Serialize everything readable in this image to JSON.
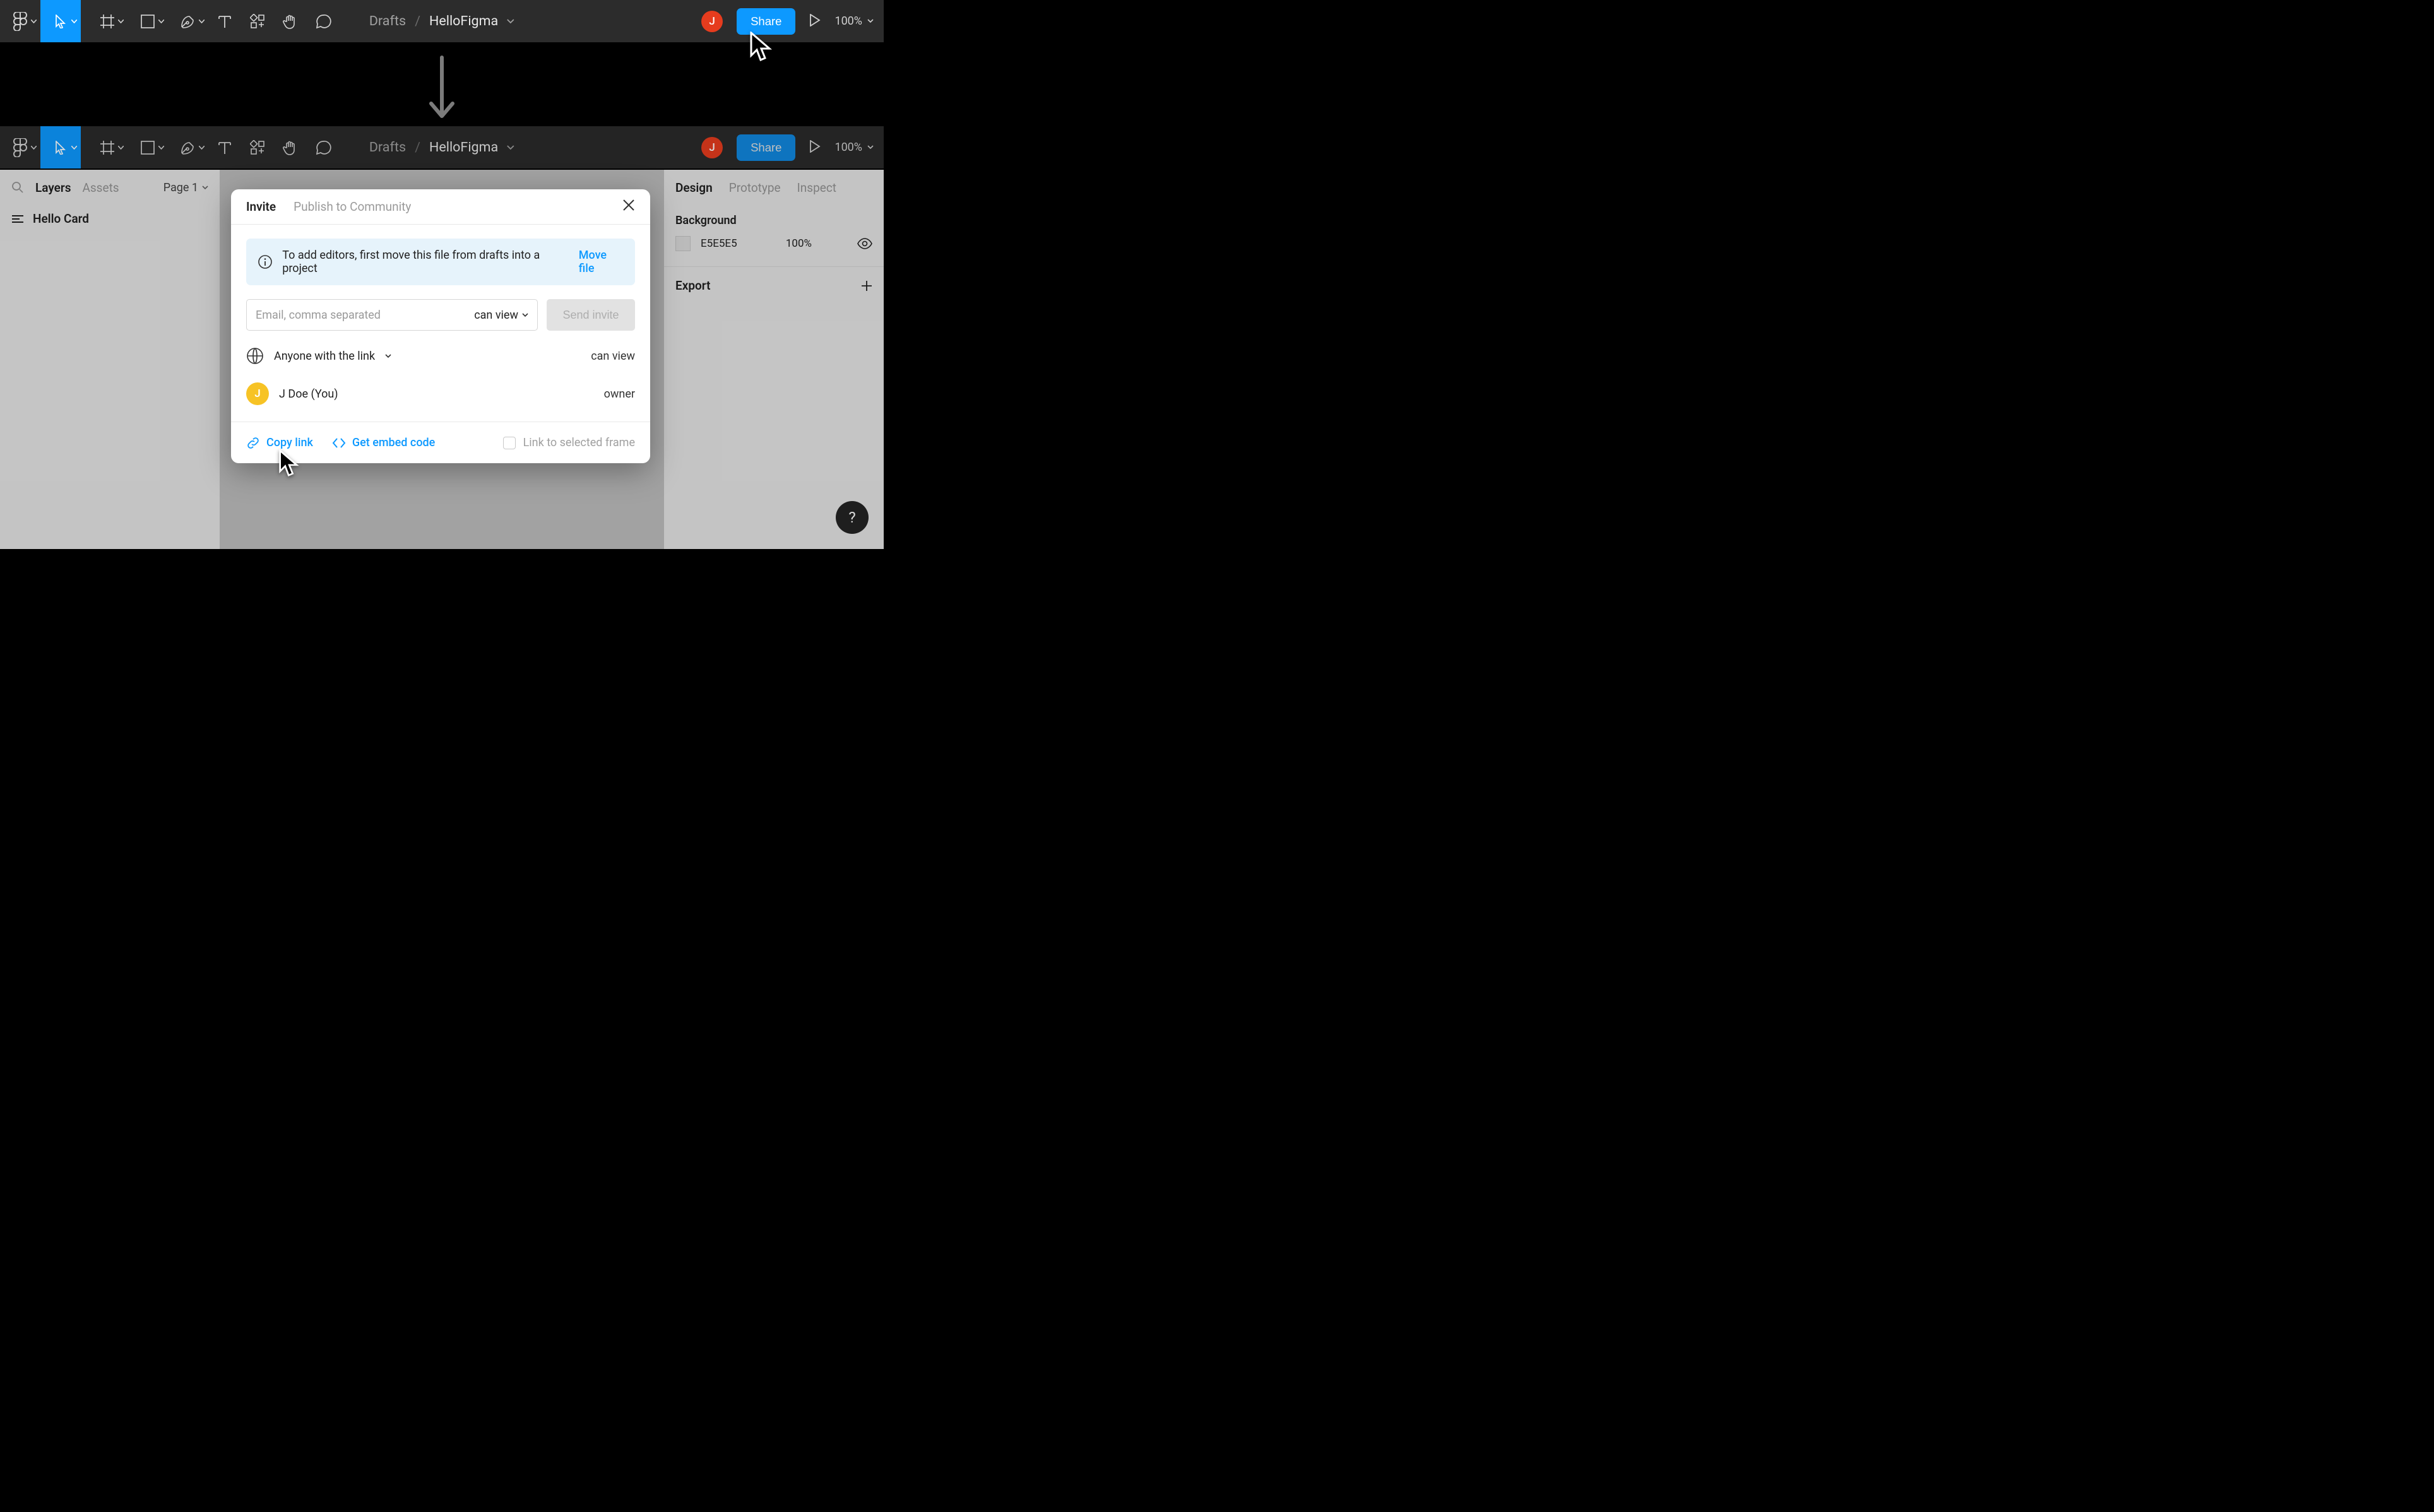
{
  "breadcrumb": {
    "drafts": "Drafts",
    "file": "HelloFigma"
  },
  "topbar": {
    "share": "Share",
    "avatar_initial": "J",
    "zoom": "100%"
  },
  "left_panel": {
    "tabs": {
      "layers": "Layers",
      "assets": "Assets"
    },
    "page": "Page 1",
    "layer0": "Hello Card"
  },
  "right_panel": {
    "tabs": {
      "design": "Design",
      "prototype": "Prototype",
      "inspect": "Inspect"
    },
    "bg_title": "Background",
    "bg_hex": "E5E5E5",
    "bg_opacity": "100%",
    "export_title": "Export"
  },
  "modal": {
    "tabs": {
      "invite": "Invite",
      "publish": "Publish to Community"
    },
    "hint_text": "To add editors, first move this file from drafts into a project",
    "hint_action": "Move file",
    "email_placeholder": "Email, comma separated",
    "email_perm": "can view",
    "send": "Send invite",
    "anyone": "Anyone with the link",
    "anyone_perm": "can view",
    "owner_name": "J Doe (You)",
    "owner_role": "owner",
    "owner_initial": "J",
    "copy_link": "Copy link",
    "embed": "Get embed code",
    "frame": "Link to selected frame"
  },
  "help": {
    "label": "?"
  }
}
